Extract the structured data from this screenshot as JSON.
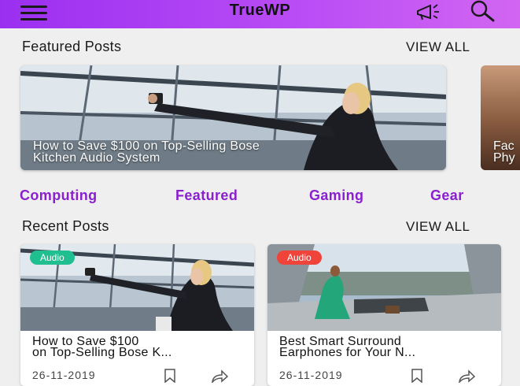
{
  "app": {
    "title": "TrueWP",
    "accent_gradient": [
      "#9b2ff0",
      "#d266f2"
    ],
    "icons": [
      "menu-icon",
      "megaphone-icon",
      "search-icon"
    ]
  },
  "featured": {
    "heading": "Featured Posts",
    "view_all": "VIEW ALL",
    "posts": [
      {
        "title_line1": "How to Save $100 on Top-Selling Bose",
        "title_line2": "Kitchen Audio System"
      },
      {
        "title_line1": "Fac",
        "title_line2": "Phy"
      }
    ]
  },
  "categories": [
    "Computing",
    "Featured",
    "Gaming",
    "Gear"
  ],
  "category_color": "#8a1fd0",
  "recent": {
    "heading": "Recent Posts",
    "view_all": "VIEW ALL",
    "posts": [
      {
        "badge": "Audio",
        "badge_color": "#1fbf8f",
        "title_line1": "How to Save $100",
        "title_line2": "on Top-Selling Bose K...",
        "date": "26-11-2019"
      },
      {
        "badge": "Audio",
        "badge_color": "#f0443a",
        "title_line1": "Best Smart Surround",
        "title_line2": "Earphones for Your N...",
        "date": "26-11-2019"
      }
    ]
  }
}
